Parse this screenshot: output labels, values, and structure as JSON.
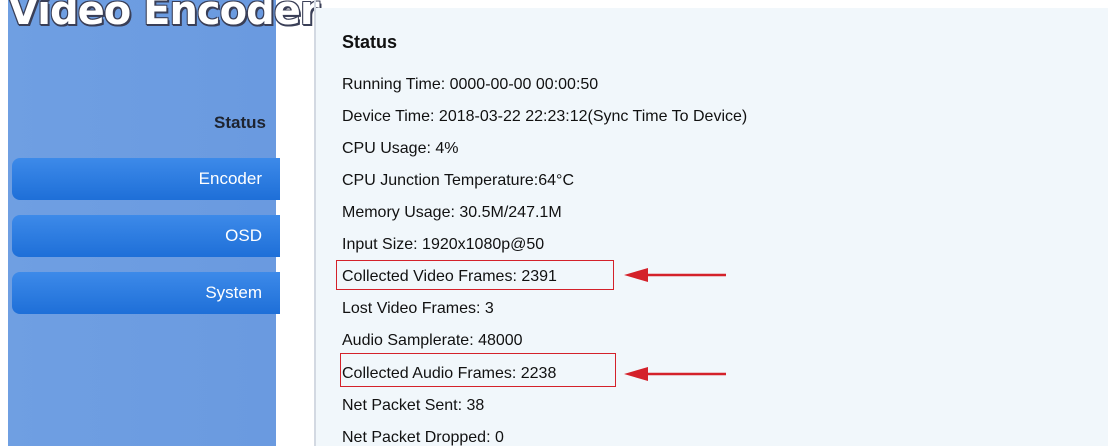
{
  "brand": {
    "title": "Video Encoder"
  },
  "sidebar": {
    "active_label": "Status",
    "items": [
      {
        "label": "Encoder"
      },
      {
        "label": "OSD"
      },
      {
        "label": "System"
      }
    ]
  },
  "status": {
    "title": "Status",
    "lines": [
      "Running Time: 0000-00-00 00:00:50",
      "Device Time: 2018-03-22 22:23:12(Sync Time To Device)",
      "CPU Usage: 4%",
      "CPU Junction Temperature:64°C",
      "Memory Usage: 30.5M/247.1M",
      "Input Size: 1920x1080p@50",
      "Collected Video Frames: 2391",
      "Lost Video Frames: 3",
      "Audio Samplerate: 48000",
      "Collected Audio Frames: 2238",
      "Net Packet Sent: 38",
      "Net Packet Dropped: 0"
    ]
  },
  "annotations": {
    "highlight_color": "#d4212a"
  }
}
